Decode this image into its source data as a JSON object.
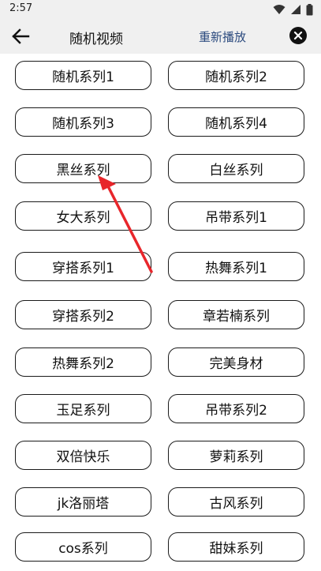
{
  "status": {
    "time": "2:57",
    "icons": [
      "wifi-icon",
      "signal-icon",
      "battery-icon"
    ]
  },
  "header": {
    "back_icon": "back-arrow-icon",
    "title": "随机视频",
    "replay_label": "重新播放",
    "close_icon": "close-icon"
  },
  "items": [
    {
      "label": "随机系列1"
    },
    {
      "label": "随机系列2"
    },
    {
      "label": "随机系列3"
    },
    {
      "label": "随机系列4"
    },
    {
      "label": "黑丝系列"
    },
    {
      "label": "白丝系列"
    },
    {
      "label": "女大系列"
    },
    {
      "label": "吊带系列1"
    },
    {
      "label": "穿搭系列1"
    },
    {
      "label": "热舞系列1"
    },
    {
      "label": "穿搭系列2"
    },
    {
      "label": "章若楠系列"
    },
    {
      "label": "热舞系列2"
    },
    {
      "label": "完美身材"
    },
    {
      "label": "玉足系列"
    },
    {
      "label": "吊带系列2"
    },
    {
      "label": "双倍快乐"
    },
    {
      "label": "萝莉系列"
    },
    {
      "label": "jk洛丽塔"
    },
    {
      "label": "古风系列"
    },
    {
      "label": "cos系列"
    },
    {
      "label": "甜妹系列"
    }
  ],
  "annotation": {
    "arrow_color": "#e8262b"
  }
}
